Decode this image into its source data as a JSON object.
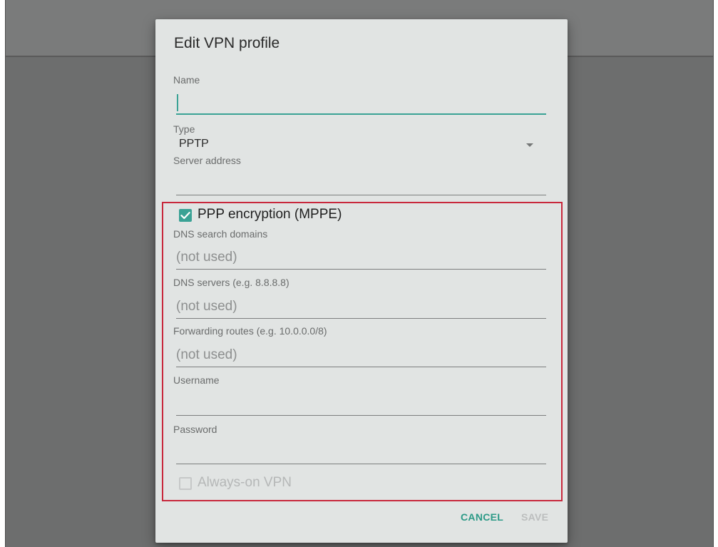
{
  "dialog": {
    "title": "Edit VPN profile",
    "name": {
      "label": "Name",
      "value": ""
    },
    "type": {
      "label": "Type",
      "selected": "PPTP"
    },
    "server": {
      "label": "Server address",
      "value": ""
    },
    "ppp_encryption": {
      "label": "PPP encryption (MPPE)",
      "checked": true
    },
    "dns_search": {
      "label": "DNS search domains",
      "placeholder": "(not used)"
    },
    "dns_servers": {
      "label": "DNS servers (e.g. 8.8.8.8)",
      "placeholder": "(not used)"
    },
    "forwarding_routes": {
      "label": "Forwarding routes (e.g. 10.0.0.0/8)",
      "placeholder": "(not used)"
    },
    "username": {
      "label": "Username",
      "value": ""
    },
    "password": {
      "label": "Password",
      "value": ""
    },
    "always_on": {
      "label": "Always-on VPN",
      "checked": false,
      "enabled": false
    },
    "buttons": {
      "cancel": "CANCEL",
      "save": "SAVE"
    }
  },
  "colors": {
    "accent": "#3aa295",
    "highlight_border": "#c8283c",
    "dialog_bg": "#e1e4e3",
    "backdrop": "#6d6e6e"
  },
  "icons": {
    "checkbox_checked": "check-icon",
    "dropdown": "triangle-down-icon"
  }
}
